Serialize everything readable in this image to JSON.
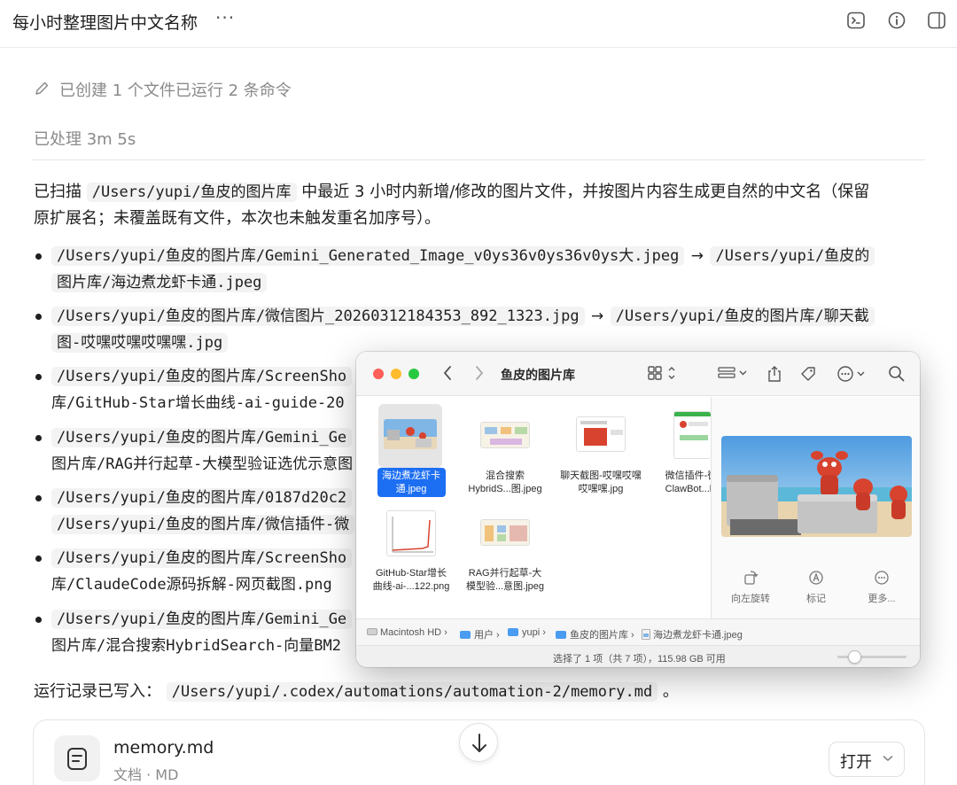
{
  "header": {
    "title": "每小时整理图片中文名称",
    "more_label": "···",
    "icons": [
      "terminal-icon",
      "info-icon",
      "sidebar-toggle-icon"
    ]
  },
  "summary": {
    "created_text": "已创建 1 个文件已运行 2 条命令",
    "processed_text": "已处理 3m 5s"
  },
  "message": {
    "intro_1": "已扫描",
    "intro_path": "/Users/yupi/鱼皮的图片库",
    "intro_2": "中最近 3 小时内新增/修改的图片文件，并按图片内容生成更自然的中文名（保留",
    "intro_3": "原扩展名；未覆盖既有文件，本次也未触发重名加序号）。",
    "items": [
      {
        "line1_a": "/Users/yupi/鱼皮的图片库/Gemini_Generated_Image_v0ys36v0ys36v0ys大.jpeg",
        "arrow": "→",
        "line1_b": "/Users/yupi/鱼皮的",
        "line2": "图片库/海边煮龙虾卡通.jpeg"
      },
      {
        "line1_a": "/Users/yupi/鱼皮的图片库/微信图片_20260312184353_892_1323.jpg",
        "arrow": "→",
        "line1_b": "/Users/yupi/鱼皮的图片库/聊天截",
        "line2": "图-哎嘿哎嘿哎嘿嘿.jpg"
      },
      {
        "line1_a": "/Users/yupi/鱼皮的图片库/ScreenSho",
        "line2": "库/GitHub-Star增长曲线-ai-guide-20"
      },
      {
        "line1_a": "/Users/yupi/鱼皮的图片库/Gemini_Ge",
        "line2": "图片库/RAG并行起草-大模型验证选优示意图"
      },
      {
        "line1_a": "/Users/yupi/鱼皮的图片库/0187d20c2",
        "line2": "/Users/yupi/鱼皮的图片库/微信插件-微"
      },
      {
        "line1_a": "/Users/yupi/鱼皮的图片库/ScreenSho",
        "line2": "库/ClaudeCode源码拆解-网页截图.png"
      },
      {
        "line1_a": "/Users/yupi/鱼皮的图片库/Gemini_Ge",
        "line2": "图片库/混合搜索HybridSearch-向量BM2"
      }
    ],
    "log_prefix": "运行记录已写入：",
    "log_path": "/Users/yupi/.codex/automations/automation-2/memory.md",
    "log_suffix": "。"
  },
  "attachment": {
    "name": "memory.md",
    "type": "文档 · MD",
    "open_label": "打开"
  },
  "finder": {
    "title": "鱼皮的图片库",
    "files": [
      {
        "name_line1": "海边煮龙虾卡",
        "name_line2": "通.jpeg",
        "selected": true
      },
      {
        "name_line1": "混合搜索",
        "name_line2": "HybridS...图.jpeg",
        "selected": false
      },
      {
        "name_line1": "聊天截图-哎嘿哎嘿",
        "name_line2": "哎嘿嘿.jpg",
        "selected": false
      },
      {
        "name_line1": "微信插件-微",
        "name_line2": "ClawBot...la",
        "selected": false
      },
      {
        "name_line1": "GitHub-Star增长",
        "name_line2": "曲线-ai-...122.png",
        "selected": false
      },
      {
        "name_line1": "RAG并行起草-大",
        "name_line2": "模型验...意图.jpeg",
        "selected": false
      }
    ],
    "actions": [
      {
        "label": "向左旋转",
        "icon": "rotate-left-icon"
      },
      {
        "label": "标记",
        "icon": "markup-icon"
      },
      {
        "label": "更多...",
        "icon": "more-icon"
      }
    ],
    "path": [
      "Macintosh HD",
      "用户",
      "yupi",
      "鱼皮的图片库",
      "海边煮龙虾卡通.jpeg"
    ],
    "status": "选择了 1 项（共 7 项），115.98 GB 可用",
    "colors": {
      "selection": "#1c6ef2",
      "close": "#fe5f57",
      "minimize": "#febc2e",
      "zoom": "#28c840"
    }
  }
}
